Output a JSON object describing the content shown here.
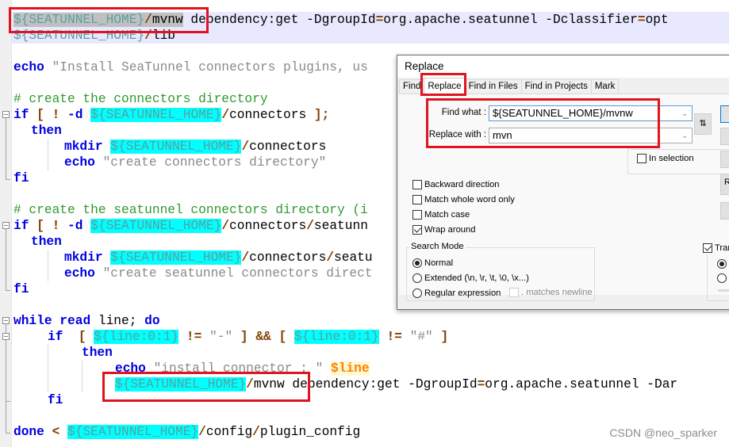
{
  "editor": {
    "lines": {
      "l1": {
        "var": "${SEATUNNEL_HOME}",
        "slash": "/",
        "cmd": "mvnw",
        "rest": " dependency:get -DgroupId",
        "eq1": "=",
        "rest2": "org.apache.seatunnel -Dclassifier",
        "eq2": "=",
        "rest3": "opt"
      },
      "l2": {
        "var": "${SEATUNNEL_HOME}",
        "slash": "/",
        "rest": "lib"
      },
      "l3": {
        "kw": "echo",
        "str": " \"Install SeaTunnel connectors plugins, us"
      },
      "l4": {
        "cmt": "# create the connectors directory"
      },
      "l5": {
        "kw1": "if",
        "op1": " [ ! ",
        "kw2": "-d",
        "sp": " ",
        "var": "${SEATUNNEL_HOME}",
        "slash": "/",
        "rest": "connectors",
        "op2": " ];"
      },
      "l6": {
        "kw": "then"
      },
      "l7": {
        "kw": "mkdir",
        "sp": " ",
        "var": "${SEATUNNEL_HOME}",
        "slash": "/",
        "rest": "connectors"
      },
      "l8": {
        "kw": "echo",
        "str": " \"create connectors directory\""
      },
      "l9": {
        "kw": "fi"
      },
      "l10": {
        "cmt": "# create the seatunnel connectors directory (i"
      },
      "l11": {
        "kw1": "if",
        "op1": " [ ! ",
        "kw2": "-d",
        "sp": " ",
        "var": "${SEATUNNEL_HOME}",
        "slash": "/",
        "rest": "connectors",
        "slash2": "/",
        "rest2": "seatunn"
      },
      "l12": {
        "kw": "then"
      },
      "l13": {
        "kw": "mkdir",
        "sp": " ",
        "var": "${SEATUNNEL_HOME}",
        "slash": "/",
        "rest": "connectors",
        "slash2": "/",
        "rest2": "seatu"
      },
      "l14": {
        "kw": "echo",
        "str": " \"create seatunnel connectors direct"
      },
      "l15": {
        "kw": "fi"
      },
      "l16": {
        "kw1": "while",
        "sp1": " ",
        "kw2": "read",
        "rest": " line; ",
        "kw3": "do"
      },
      "l17": {
        "kw": "if",
        "op1": "  [ ",
        "var1": "${line:0:1}",
        "op2": " != ",
        "str1": "\"-\"",
        "op3": " ] && [ ",
        "var2": "${line:0:1}",
        "op4": " != ",
        "str2": "\"#\"",
        "op5": " ]"
      },
      "l18": {
        "kw": "then"
      },
      "l19": {
        "kw": "echo",
        "str": " \"install connector : \" ",
        "dollar": "$line"
      },
      "l20": {
        "var": "${SEATUNNEL_HOME}",
        "slash": "/",
        "cmd": "mvnw",
        "rest": " dependency:get -DgroupId",
        "eq": "=",
        "rest2": "org.apache.seatunnel -Dar"
      },
      "l21": {
        "kw": "fi"
      },
      "l22": {
        "kw": "done",
        "op": " < ",
        "var": "${SEATUNNEL_HOME}",
        "slash": "/",
        "rest": "config",
        "slash2": "/",
        "rest2": "plugin_config"
      }
    }
  },
  "dialog": {
    "title": "Replace",
    "tabs": [
      "Find",
      "Replace",
      "Find in Files",
      "Find in Projects",
      "Mark"
    ],
    "active_tab": "Replace",
    "find_what_label": "Find what :",
    "find_what_value": "${SEATUNNEL_HOME}/mvnw",
    "replace_with_label": "Replace with :",
    "replace_with_value": "mvn",
    "swap_icon": "⇅",
    "in_selection_label": "In selection",
    "in_selection_checked": false,
    "options": [
      {
        "label": "Backward direction",
        "checked": false
      },
      {
        "label": "Match whole word only",
        "checked": false
      },
      {
        "label": "Match case",
        "checked": false
      },
      {
        "label": "Wrap around",
        "checked": true
      }
    ],
    "search_mode": {
      "title": "Search Mode",
      "options": [
        {
          "label": "Normal",
          "selected": true
        },
        {
          "label": "Extended (\\n, \\r, \\t, \\0, \\x...)",
          "selected": false
        },
        {
          "label": "Regular expression",
          "selected": false
        }
      ],
      "matches_newline_label": ". matches newline"
    },
    "transparency_label": "Tran",
    "transparency_checked": true,
    "side_button_partial_label": "R"
  },
  "watermark": "CSDN @neo_sparker"
}
